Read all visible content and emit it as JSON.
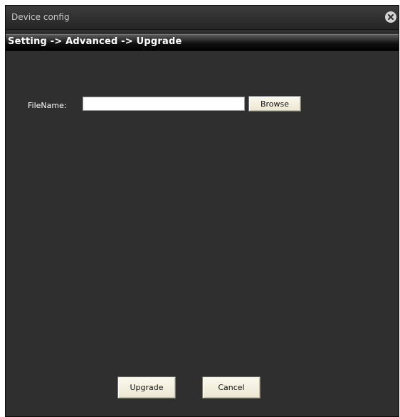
{
  "window": {
    "title": "Device config"
  },
  "breadcrumb": {
    "text": "Setting -> Advanced -> Upgrade"
  },
  "form": {
    "filename_label": "FileName:",
    "filename_value": "",
    "browse_label": "Browse"
  },
  "actions": {
    "upgrade_label": "Upgrade",
    "cancel_label": "Cancel"
  },
  "icons": {
    "close": "close-icon"
  }
}
